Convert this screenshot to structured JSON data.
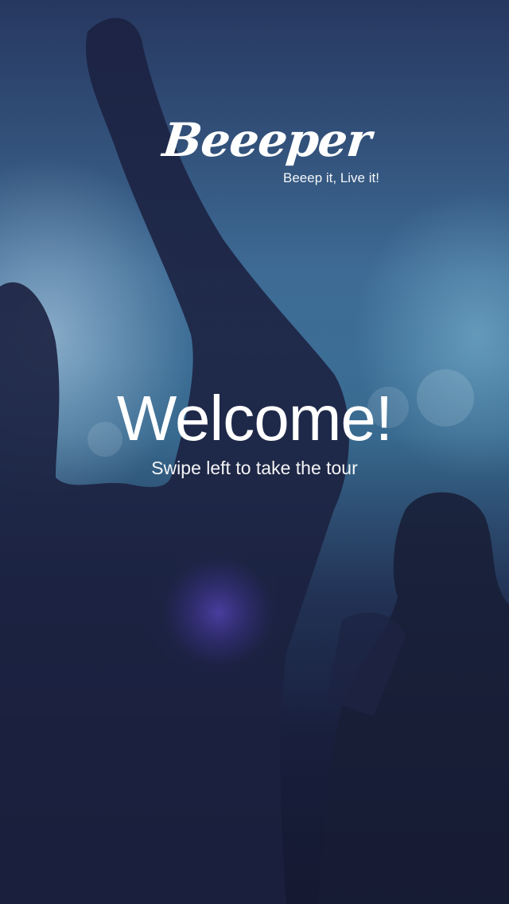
{
  "brand": {
    "logo_text": "Beeeper",
    "tagline": "Beeep it, Live it!"
  },
  "welcome": {
    "title": "Welcome!",
    "subtitle": "Swipe left to take the tour"
  }
}
